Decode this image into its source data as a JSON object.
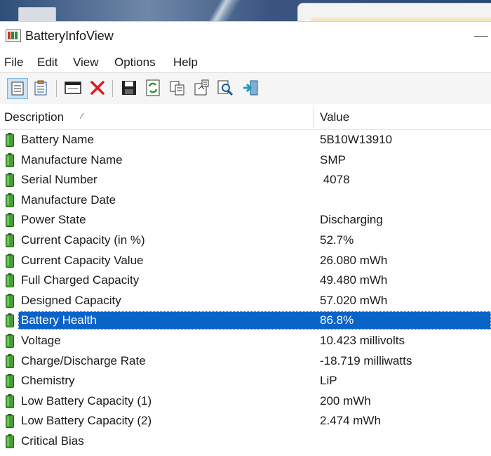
{
  "window": {
    "title": "BatteryInfoView"
  },
  "menu": [
    "File",
    "Edit",
    "View",
    "Options",
    "Help"
  ],
  "toolbar": {
    "buttons": [
      {
        "icon": "view-list-icon"
      },
      {
        "icon": "view-properties-icon"
      },
      {
        "icon": "window-icon"
      },
      {
        "icon": "delete-x-icon"
      },
      {
        "icon": "save-disk-icon"
      },
      {
        "icon": "refresh-icon"
      },
      {
        "icon": "copy-icon"
      },
      {
        "icon": "properties-icon"
      },
      {
        "icon": "find-icon"
      },
      {
        "icon": "exit-icon"
      }
    ]
  },
  "columns": {
    "description": "Description",
    "value": "Value"
  },
  "rows": [
    {
      "description": "Battery Name",
      "value": "5B10W13910"
    },
    {
      "description": "Manufacture Name",
      "value": "SMP"
    },
    {
      "description": "Serial Number",
      "value": " 4078"
    },
    {
      "description": "Manufacture Date",
      "value": ""
    },
    {
      "description": "Power State",
      "value": "Discharging"
    },
    {
      "description": "Current Capacity (in %)",
      "value": "52.7%"
    },
    {
      "description": "Current Capacity Value",
      "value": "26.080 mWh"
    },
    {
      "description": "Full Charged Capacity",
      "value": "49.480 mWh"
    },
    {
      "description": "Designed Capacity",
      "value": "57.020 mWh"
    },
    {
      "description": "Battery Health",
      "value": "86.8%",
      "selected": true
    },
    {
      "description": "Voltage",
      "value": "10.423 millivolts"
    },
    {
      "description": "Charge/Discharge Rate",
      "value": "-18.719 milliwatts"
    },
    {
      "description": "Chemistry",
      "value": "LiP"
    },
    {
      "description": "Low Battery Capacity (1)",
      "value": "200 mWh"
    },
    {
      "description": "Low Battery Capacity (2)",
      "value": "2.474 mWh"
    },
    {
      "description": "Critical Bias",
      "value": ""
    }
  ],
  "colors": {
    "selection": "#0a63c9",
    "battery_green": "#3a8a2a"
  }
}
